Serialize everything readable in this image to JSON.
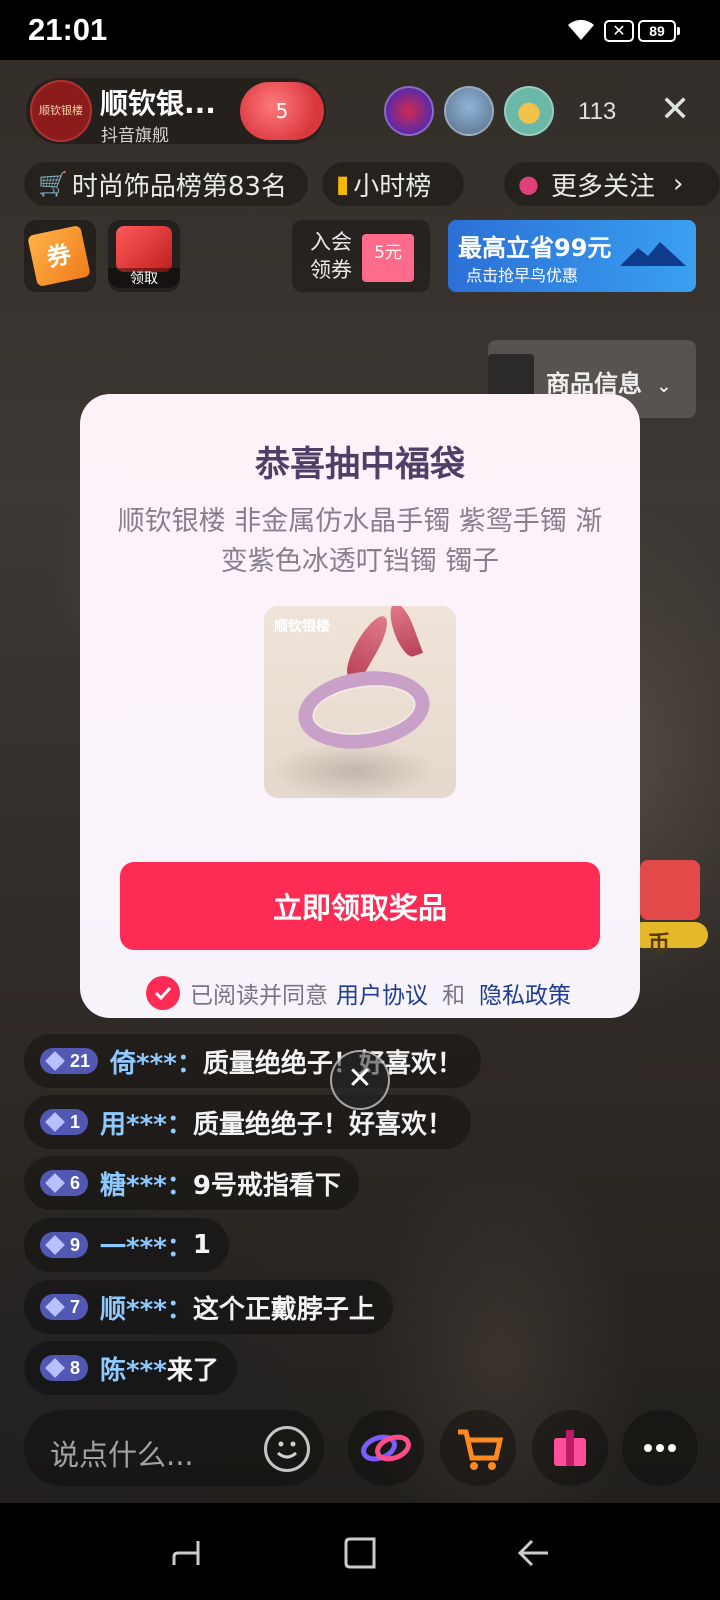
{
  "status_bar": {
    "time": "21:01",
    "battery": "89"
  },
  "live_header": {
    "anchor_logo": "顺钦银楼",
    "anchor_name": "顺钦银...",
    "anchor_subtitle": "抖音旗舰",
    "like_count": "5",
    "viewer_count": "113"
  },
  "chips": {
    "rank": "时尚饰品榜第83名",
    "hourly": "小时榜",
    "more_follow": "更多关注"
  },
  "coupons": {
    "coupon_char": "券",
    "claim_label": "领取",
    "member_line1": "入会",
    "member_line2": "领券",
    "member_amount": "5元",
    "promo_title": "最高立省99元",
    "promo_sub": "点击抢早鸟优惠"
  },
  "product_info": {
    "label": "商品信息"
  },
  "modal": {
    "title": "恭喜抽中福袋",
    "description": "顺钦银楼 非金属仿水晶手镯 紫鸳手镯 渐变紫色冰透叮铛镯 镯子",
    "image_brand": "顺钦银楼",
    "claim_button": "立即领取奖品",
    "agree_prefix": "已阅读并同意",
    "user_agreement": "用户协议",
    "and": "和",
    "privacy_policy": "隐私政策"
  },
  "side_gift": {
    "label": "币"
  },
  "comments": [
    {
      "level": "21",
      "user": "倚***：",
      "text": "质量绝绝子！好喜欢！"
    },
    {
      "level": "1",
      "user": "用***：",
      "text": "质量绝绝子！好喜欢！"
    },
    {
      "level": "6",
      "user": "糖***：",
      "text": "9号戒指看下"
    },
    {
      "level": "9",
      "user": "一***：",
      "text": "1"
    },
    {
      "level": "7",
      "user": "顺***：",
      "text": "这个正戴脖子上"
    },
    {
      "level": "8",
      "user": "陈***",
      "text": " 来了"
    }
  ],
  "bottom_bar": {
    "placeholder": "说点什么..."
  }
}
